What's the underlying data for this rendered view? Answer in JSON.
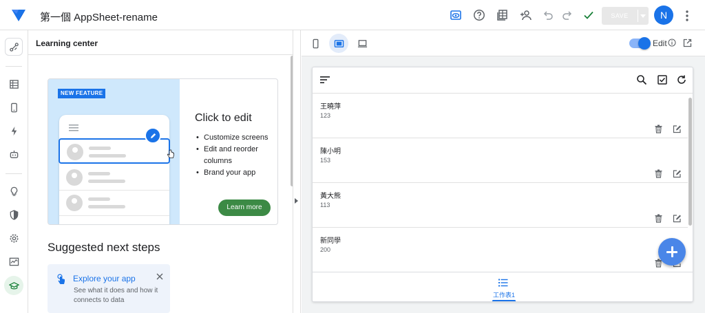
{
  "header": {
    "app_title": "第一個 AppSheet-rename",
    "save_label": "SAVE",
    "avatar_initial": "N",
    "icons": [
      "appsheet-logo-icon",
      "preview-eye-icon",
      "help-icon",
      "table-icon",
      "share-icon",
      "undo-icon",
      "redo-icon",
      "check-icon",
      "more-vert-icon"
    ]
  },
  "rail": {
    "items": [
      "home-icon",
      "data-icon",
      "app-icon",
      "automation-icon",
      "bot-icon",
      "ideas-icon",
      "security-icon",
      "settings-icon",
      "monitor-icon",
      "learning-icon"
    ]
  },
  "learning_center": {
    "title": "Learning center",
    "feature": {
      "badge": "NEW FEATURE",
      "title": "Click to edit",
      "bullets": [
        "Customize screens",
        "Edit and reorder columns",
        "Brand your app"
      ],
      "button": "Learn more"
    },
    "next_steps_title": "Suggested next steps",
    "explore": {
      "title": "Explore your app",
      "description": "See what it does and how it connects to data"
    }
  },
  "preview": {
    "edit_label": "Edit",
    "rows": [
      {
        "name": "王曉萍",
        "value": "123"
      },
      {
        "name": "陳小明",
        "value": "153"
      },
      {
        "name": "黃大熊",
        "value": "113"
      },
      {
        "name": "新同學",
        "value": "200"
      }
    ],
    "nav_label": "工作表1"
  },
  "colors": {
    "accent": "#1a73e8",
    "learn_more": "#3c8a45",
    "fab": "#4a86e8"
  }
}
